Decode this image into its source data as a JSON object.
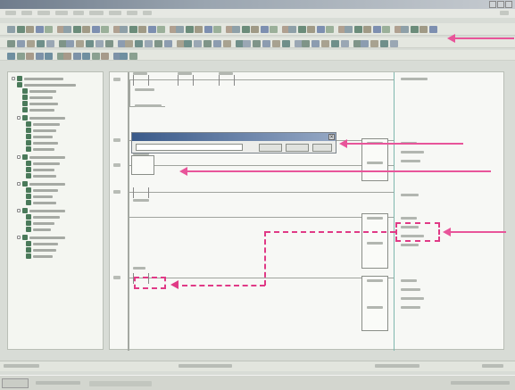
{
  "annotation": {
    "color": "#e8559a",
    "arrows": [
      "toolbar-pointer",
      "dialog-pointer",
      "contact-pointer",
      "output-pointer"
    ]
  },
  "icons": [
    "close-icon",
    "minimize-icon",
    "maximize-icon",
    "folder-icon",
    "expand-icon",
    "start-icon"
  ]
}
